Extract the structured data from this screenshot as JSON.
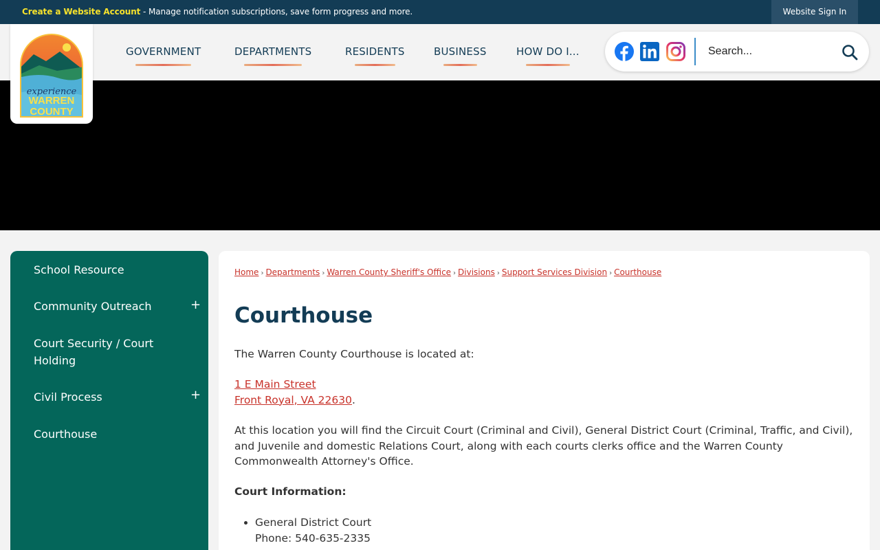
{
  "topbar": {
    "create_account": "Create a Website Account",
    "message": " - Manage notification subscriptions, save form progress and more.",
    "sign_in": "Website Sign In"
  },
  "logo": {
    "line1": "experience",
    "line2": "WARREN",
    "line3": "COUNTY"
  },
  "nav": {
    "items": [
      {
        "label": "GOVERNMENT"
      },
      {
        "label": "DEPARTMENTS"
      },
      {
        "label": "RESIDENTS"
      },
      {
        "label": "BUSINESS"
      },
      {
        "label": "HOW DO I..."
      }
    ]
  },
  "search": {
    "placeholder": "Search..."
  },
  "social": [
    "facebook-icon",
    "linkedin-icon",
    "instagram-icon"
  ],
  "sidebar": {
    "items": [
      {
        "label": "School Resource"
      },
      {
        "label": "Community Outreach",
        "expandable": "+"
      },
      {
        "label": "Court Security / Court Holding"
      },
      {
        "label": "Civil Process",
        "expandable": "+"
      },
      {
        "label": "Courthouse"
      }
    ]
  },
  "breadcrumb": [
    "Home",
    "Departments",
    "Warren County Sheriff's Office",
    "Divisions",
    "Support Services Division",
    "Courthouse"
  ],
  "page": {
    "title": "Courthouse",
    "intro": "The Warren County Courthouse is located at:",
    "address_line1": "1 E Main Street",
    "address_line2": "Front Royal, VA 22630",
    "address_period": ".",
    "description": "At this location you will find the Circuit Court (Criminal and Civil), General District Court (Criminal, Traffic, and Civil), and Juvenile and domestic Relations Court, along with each courts clerks office and the Warren County Commonwealth Attorney's Office.",
    "court_info_heading": "Court Information:",
    "courts": [
      {
        "name": "General District Court",
        "phone": "Phone: 540-635-2335"
      }
    ]
  },
  "colors": {
    "navy": "#133c55",
    "green": "#04665a",
    "red_link": "#c8322a",
    "yellow_accent": "#f5e12c"
  }
}
